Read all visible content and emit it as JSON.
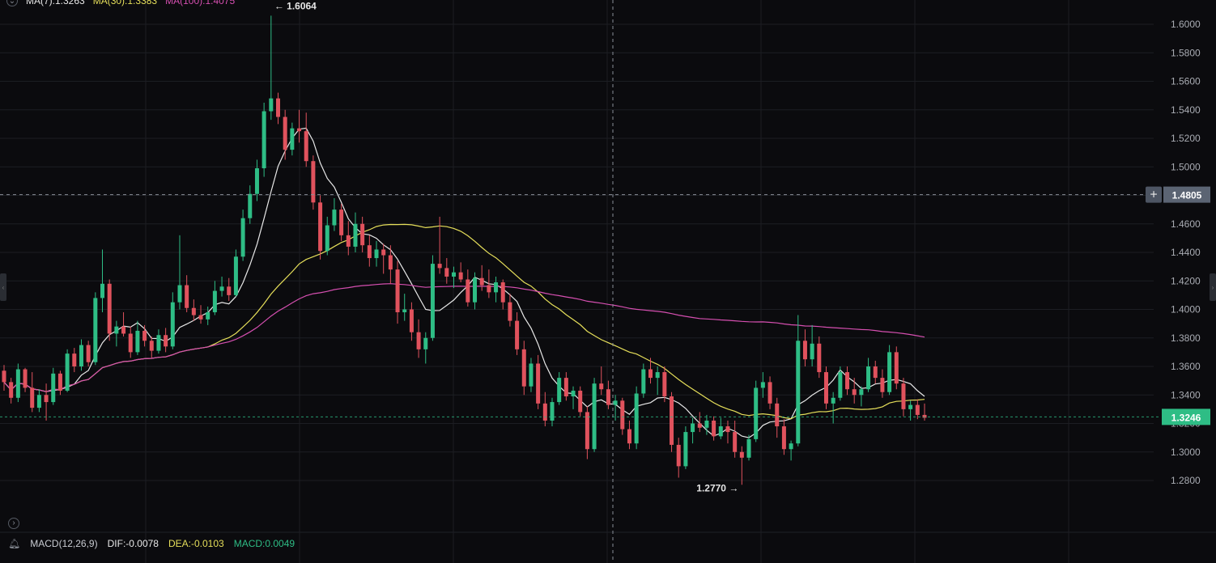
{
  "legend": {
    "ma7_label": "MA(7):1.3263",
    "ma30_label": "MA(30):1.3383",
    "ma100_label": "MA(100):1.4075"
  },
  "macd": {
    "label": "MACD(12,26,9)",
    "dif": "DIF:-0.0078",
    "dea": "DEA:-0.0103",
    "macd": "MACD:0.0049"
  },
  "colors": {
    "up": "#2ebd85",
    "down": "#e0525d",
    "ma7": "#e8e8e8",
    "ma30": "#e6df5a",
    "ma100": "#d54fb0",
    "grid": "#1c1e23",
    "crosshair_tag": "#5b6473",
    "last_price_tag": "#2ebd85"
  },
  "chart_data": {
    "type": "candlestick",
    "y_axis": {
      "ticks": [
        "1.6000",
        "1.5800",
        "1.5600",
        "1.5400",
        "1.5200",
        "1.5000",
        "1.4800",
        "1.4600",
        "1.4400",
        "1.4200",
        "1.4000",
        "1.3800",
        "1.3600",
        "1.3400",
        "1.3200",
        "1.3000",
        "1.2800"
      ],
      "ylim": [
        1.26,
        1.62
      ]
    },
    "crosshair_price": "1.4805",
    "last_price": "1.3246",
    "annotations": {
      "high": "1.6064",
      "low": "1.2770"
    },
    "candles": [
      [
        1.357,
        1.361,
        1.343,
        1.349
      ],
      [
        1.349,
        1.352,
        1.334,
        1.338
      ],
      [
        1.338,
        1.362,
        1.335,
        1.358
      ],
      [
        1.358,
        1.359,
        1.342,
        1.345
      ],
      [
        1.345,
        1.356,
        1.328,
        1.331
      ],
      [
        1.331,
        1.344,
        1.328,
        1.34
      ],
      [
        1.34,
        1.348,
        1.322,
        1.335
      ],
      [
        1.335,
        1.359,
        1.333,
        1.355
      ],
      [
        1.355,
        1.357,
        1.34,
        1.343
      ],
      [
        1.343,
        1.372,
        1.342,
        1.369
      ],
      [
        1.369,
        1.373,
        1.356,
        1.36
      ],
      [
        1.36,
        1.379,
        1.357,
        1.375
      ],
      [
        1.375,
        1.378,
        1.36,
        1.363
      ],
      [
        1.363,
        1.412,
        1.361,
        1.408
      ],
      [
        1.408,
        1.442,
        1.398,
        1.418
      ],
      [
        1.418,
        1.421,
        1.378,
        1.383
      ],
      [
        1.383,
        1.392,
        1.374,
        1.388
      ],
      [
        1.388,
        1.398,
        1.381,
        1.383
      ],
      [
        1.383,
        1.388,
        1.366,
        1.37
      ],
      [
        1.37,
        1.392,
        1.368,
        1.385
      ],
      [
        1.385,
        1.389,
        1.374,
        1.378
      ],
      [
        1.378,
        1.381,
        1.366,
        1.371
      ],
      [
        1.371,
        1.386,
        1.369,
        1.382
      ],
      [
        1.382,
        1.387,
        1.37,
        1.374
      ],
      [
        1.374,
        1.412,
        1.372,
        1.405
      ],
      [
        1.405,
        1.452,
        1.4,
        1.417
      ],
      [
        1.417,
        1.424,
        1.398,
        1.401
      ],
      [
        1.401,
        1.407,
        1.392,
        1.396
      ],
      [
        1.396,
        1.403,
        1.39,
        1.393
      ],
      [
        1.393,
        1.402,
        1.389,
        1.398
      ],
      [
        1.398,
        1.42,
        1.396,
        1.413
      ],
      [
        1.413,
        1.423,
        1.409,
        1.416
      ],
      [
        1.416,
        1.422,
        1.406,
        1.41
      ],
      [
        1.41,
        1.442,
        1.409,
        1.437
      ],
      [
        1.437,
        1.47,
        1.434,
        1.464
      ],
      [
        1.464,
        1.487,
        1.46,
        1.481
      ],
      [
        1.481,
        1.505,
        1.476,
        1.499
      ],
      [
        1.499,
        1.545,
        1.493,
        1.539
      ],
      [
        1.539,
        1.606,
        1.533,
        1.548
      ],
      [
        1.548,
        1.552,
        1.53,
        1.535
      ],
      [
        1.535,
        1.54,
        1.505,
        1.512
      ],
      [
        1.512,
        1.531,
        1.508,
        1.527
      ],
      [
        1.527,
        1.54,
        1.517,
        1.525
      ],
      [
        1.525,
        1.538,
        1.5,
        1.504
      ],
      [
        1.504,
        1.508,
        1.47,
        1.475
      ],
      [
        1.475,
        1.48,
        1.435,
        1.441
      ],
      [
        1.441,
        1.465,
        1.438,
        1.459
      ],
      [
        1.459,
        1.478,
        1.455,
        1.47
      ],
      [
        1.47,
        1.474,
        1.448,
        1.452
      ],
      [
        1.452,
        1.462,
        1.438,
        1.444
      ],
      [
        1.444,
        1.468,
        1.44,
        1.46
      ],
      [
        1.46,
        1.465,
        1.44,
        1.445
      ],
      [
        1.445,
        1.452,
        1.43,
        1.436
      ],
      [
        1.436,
        1.448,
        1.43,
        1.442
      ],
      [
        1.442,
        1.446,
        1.425,
        1.438
      ],
      [
        1.438,
        1.445,
        1.418,
        1.428
      ],
      [
        1.428,
        1.434,
        1.39,
        1.398
      ],
      [
        1.398,
        1.411,
        1.392,
        1.4
      ],
      [
        1.4,
        1.405,
        1.378,
        1.384
      ],
      [
        1.384,
        1.393,
        1.366,
        1.372
      ],
      [
        1.372,
        1.384,
        1.362,
        1.38
      ],
      [
        1.38,
        1.438,
        1.378,
        1.432
      ],
      [
        1.432,
        1.465,
        1.425,
        1.429
      ],
      [
        1.429,
        1.436,
        1.418,
        1.423
      ],
      [
        1.423,
        1.43,
        1.415,
        1.426
      ],
      [
        1.426,
        1.433,
        1.419,
        1.421
      ],
      [
        1.421,
        1.428,
        1.402,
        1.405
      ],
      [
        1.405,
        1.426,
        1.4,
        1.422
      ],
      [
        1.422,
        1.431,
        1.413,
        1.417
      ],
      [
        1.417,
        1.428,
        1.408,
        1.412
      ],
      [
        1.412,
        1.423,
        1.405,
        1.419
      ],
      [
        1.419,
        1.421,
        1.4,
        1.405
      ],
      [
        1.405,
        1.411,
        1.388,
        1.392
      ],
      [
        1.392,
        1.398,
        1.368,
        1.372
      ],
      [
        1.372,
        1.378,
        1.34,
        1.346
      ],
      [
        1.346,
        1.366,
        1.342,
        1.362
      ],
      [
        1.362,
        1.368,
        1.33,
        1.334
      ],
      [
        1.334,
        1.342,
        1.318,
        1.322
      ],
      [
        1.322,
        1.338,
        1.318,
        1.335
      ],
      [
        1.335,
        1.356,
        1.333,
        1.352
      ],
      [
        1.352,
        1.356,
        1.336,
        1.339
      ],
      [
        1.339,
        1.346,
        1.33,
        1.343
      ],
      [
        1.343,
        1.346,
        1.325,
        1.328
      ],
      [
        1.328,
        1.332,
        1.295,
        1.302
      ],
      [
        1.302,
        1.352,
        1.3,
        1.348
      ],
      [
        1.348,
        1.36,
        1.34,
        1.344
      ],
      [
        1.344,
        1.35,
        1.33,
        1.333
      ],
      [
        1.333,
        1.34,
        1.322,
        1.336
      ],
      [
        1.336,
        1.338,
        1.312,
        1.316
      ],
      [
        1.316,
        1.322,
        1.302,
        1.306
      ],
      [
        1.306,
        1.346,
        1.302,
        1.341
      ],
      [
        1.341,
        1.362,
        1.338,
        1.358
      ],
      [
        1.358,
        1.366,
        1.348,
        1.352
      ],
      [
        1.352,
        1.36,
        1.34,
        1.356
      ],
      [
        1.356,
        1.36,
        1.335,
        1.339
      ],
      [
        1.339,
        1.342,
        1.3,
        1.305
      ],
      [
        1.305,
        1.31,
        1.282,
        1.29
      ],
      [
        1.29,
        1.318,
        1.288,
        1.314
      ],
      [
        1.314,
        1.324,
        1.306,
        1.32
      ],
      [
        1.32,
        1.328,
        1.314,
        1.317
      ],
      [
        1.317,
        1.326,
        1.312,
        1.322
      ],
      [
        1.322,
        1.325,
        1.308,
        1.311
      ],
      [
        1.311,
        1.324,
        1.309,
        1.318
      ],
      [
        1.318,
        1.322,
        1.306,
        1.314
      ],
      [
        1.314,
        1.322,
        1.296,
        1.3
      ],
      [
        1.3,
        1.304,
        1.277,
        1.296
      ],
      [
        1.296,
        1.312,
        1.294,
        1.309
      ],
      [
        1.309,
        1.35,
        1.307,
        1.345
      ],
      [
        1.345,
        1.356,
        1.338,
        1.349
      ],
      [
        1.349,
        1.353,
        1.33,
        1.334
      ],
      [
        1.334,
        1.338,
        1.31,
        1.318
      ],
      [
        1.318,
        1.323,
        1.298,
        1.302
      ],
      [
        1.302,
        1.308,
        1.294,
        1.306
      ],
      [
        1.306,
        1.396,
        1.304,
        1.378
      ],
      [
        1.378,
        1.386,
        1.36,
        1.365
      ],
      [
        1.365,
        1.389,
        1.36,
        1.376
      ],
      [
        1.376,
        1.381,
        1.352,
        1.356
      ],
      [
        1.356,
        1.36,
        1.33,
        1.334
      ],
      [
        1.334,
        1.342,
        1.32,
        1.338
      ],
      [
        1.338,
        1.36,
        1.336,
        1.356
      ],
      [
        1.356,
        1.36,
        1.34,
        1.344
      ],
      [
        1.344,
        1.352,
        1.334,
        1.34
      ],
      [
        1.34,
        1.346,
        1.332,
        1.344
      ],
      [
        1.344,
        1.366,
        1.342,
        1.36
      ],
      [
        1.36,
        1.364,
        1.348,
        1.352
      ],
      [
        1.352,
        1.358,
        1.338,
        1.342
      ],
      [
        1.342,
        1.375,
        1.34,
        1.37
      ],
      [
        1.37,
        1.374,
        1.344,
        1.348
      ],
      [
        1.348,
        1.352,
        1.325,
        1.33
      ],
      [
        1.33,
        1.336,
        1.322,
        1.333
      ],
      [
        1.333,
        1.337,
        1.323,
        1.326
      ],
      [
        1.326,
        1.334,
        1.322,
        1.324
      ]
    ]
  }
}
